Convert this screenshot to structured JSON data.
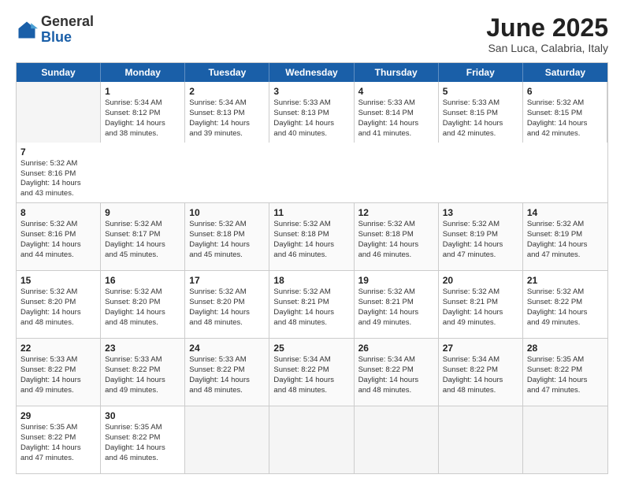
{
  "logo": {
    "general": "General",
    "blue": "Blue"
  },
  "header": {
    "month": "June 2025",
    "location": "San Luca, Calabria, Italy"
  },
  "days": [
    "Sunday",
    "Monday",
    "Tuesday",
    "Wednesday",
    "Thursday",
    "Friday",
    "Saturday"
  ],
  "rows": [
    [
      {
        "day": "",
        "empty": true
      },
      {
        "day": "2",
        "lines": [
          "Sunrise: 5:34 AM",
          "Sunset: 8:13 PM",
          "Daylight: 14 hours",
          "and 39 minutes."
        ]
      },
      {
        "day": "3",
        "lines": [
          "Sunrise: 5:33 AM",
          "Sunset: 8:13 PM",
          "Daylight: 14 hours",
          "and 40 minutes."
        ]
      },
      {
        "day": "4",
        "lines": [
          "Sunrise: 5:33 AM",
          "Sunset: 8:14 PM",
          "Daylight: 14 hours",
          "and 41 minutes."
        ]
      },
      {
        "day": "5",
        "lines": [
          "Sunrise: 5:33 AM",
          "Sunset: 8:15 PM",
          "Daylight: 14 hours",
          "and 42 minutes."
        ]
      },
      {
        "day": "6",
        "lines": [
          "Sunrise: 5:32 AM",
          "Sunset: 8:15 PM",
          "Daylight: 14 hours",
          "and 42 minutes."
        ]
      },
      {
        "day": "7",
        "lines": [
          "Sunrise: 5:32 AM",
          "Sunset: 8:16 PM",
          "Daylight: 14 hours",
          "and 43 minutes."
        ]
      }
    ],
    [
      {
        "day": "8",
        "lines": [
          "Sunrise: 5:32 AM",
          "Sunset: 8:16 PM",
          "Daylight: 14 hours",
          "and 44 minutes."
        ]
      },
      {
        "day": "9",
        "lines": [
          "Sunrise: 5:32 AM",
          "Sunset: 8:17 PM",
          "Daylight: 14 hours",
          "and 45 minutes."
        ]
      },
      {
        "day": "10",
        "lines": [
          "Sunrise: 5:32 AM",
          "Sunset: 8:18 PM",
          "Daylight: 14 hours",
          "and 45 minutes."
        ]
      },
      {
        "day": "11",
        "lines": [
          "Sunrise: 5:32 AM",
          "Sunset: 8:18 PM",
          "Daylight: 14 hours",
          "and 46 minutes."
        ]
      },
      {
        "day": "12",
        "lines": [
          "Sunrise: 5:32 AM",
          "Sunset: 8:18 PM",
          "Daylight: 14 hours",
          "and 46 minutes."
        ]
      },
      {
        "day": "13",
        "lines": [
          "Sunrise: 5:32 AM",
          "Sunset: 8:19 PM",
          "Daylight: 14 hours",
          "and 47 minutes."
        ]
      },
      {
        "day": "14",
        "lines": [
          "Sunrise: 5:32 AM",
          "Sunset: 8:19 PM",
          "Daylight: 14 hours",
          "and 47 minutes."
        ]
      }
    ],
    [
      {
        "day": "15",
        "lines": [
          "Sunrise: 5:32 AM",
          "Sunset: 8:20 PM",
          "Daylight: 14 hours",
          "and 48 minutes."
        ]
      },
      {
        "day": "16",
        "lines": [
          "Sunrise: 5:32 AM",
          "Sunset: 8:20 PM",
          "Daylight: 14 hours",
          "and 48 minutes."
        ]
      },
      {
        "day": "17",
        "lines": [
          "Sunrise: 5:32 AM",
          "Sunset: 8:20 PM",
          "Daylight: 14 hours",
          "and 48 minutes."
        ]
      },
      {
        "day": "18",
        "lines": [
          "Sunrise: 5:32 AM",
          "Sunset: 8:21 PM",
          "Daylight: 14 hours",
          "and 48 minutes."
        ]
      },
      {
        "day": "19",
        "lines": [
          "Sunrise: 5:32 AM",
          "Sunset: 8:21 PM",
          "Daylight: 14 hours",
          "and 49 minutes."
        ]
      },
      {
        "day": "20",
        "lines": [
          "Sunrise: 5:32 AM",
          "Sunset: 8:21 PM",
          "Daylight: 14 hours",
          "and 49 minutes."
        ]
      },
      {
        "day": "21",
        "lines": [
          "Sunrise: 5:32 AM",
          "Sunset: 8:22 PM",
          "Daylight: 14 hours",
          "and 49 minutes."
        ]
      }
    ],
    [
      {
        "day": "22",
        "lines": [
          "Sunrise: 5:33 AM",
          "Sunset: 8:22 PM",
          "Daylight: 14 hours",
          "and 49 minutes."
        ]
      },
      {
        "day": "23",
        "lines": [
          "Sunrise: 5:33 AM",
          "Sunset: 8:22 PM",
          "Daylight: 14 hours",
          "and 49 minutes."
        ]
      },
      {
        "day": "24",
        "lines": [
          "Sunrise: 5:33 AM",
          "Sunset: 8:22 PM",
          "Daylight: 14 hours",
          "and 48 minutes."
        ]
      },
      {
        "day": "25",
        "lines": [
          "Sunrise: 5:34 AM",
          "Sunset: 8:22 PM",
          "Daylight: 14 hours",
          "and 48 minutes."
        ]
      },
      {
        "day": "26",
        "lines": [
          "Sunrise: 5:34 AM",
          "Sunset: 8:22 PM",
          "Daylight: 14 hours",
          "and 48 minutes."
        ]
      },
      {
        "day": "27",
        "lines": [
          "Sunrise: 5:34 AM",
          "Sunset: 8:22 PM",
          "Daylight: 14 hours",
          "and 48 minutes."
        ]
      },
      {
        "day": "28",
        "lines": [
          "Sunrise: 5:35 AM",
          "Sunset: 8:22 PM",
          "Daylight: 14 hours",
          "and 47 minutes."
        ]
      }
    ],
    [
      {
        "day": "29",
        "lines": [
          "Sunrise: 5:35 AM",
          "Sunset: 8:22 PM",
          "Daylight: 14 hours",
          "and 47 minutes."
        ]
      },
      {
        "day": "30",
        "lines": [
          "Sunrise: 5:35 AM",
          "Sunset: 8:22 PM",
          "Daylight: 14 hours",
          "and 46 minutes."
        ]
      },
      {
        "day": "",
        "empty": true
      },
      {
        "day": "",
        "empty": true
      },
      {
        "day": "",
        "empty": true
      },
      {
        "day": "",
        "empty": true
      },
      {
        "day": "",
        "empty": true
      }
    ]
  ],
  "row0_col1": {
    "day": "1",
    "lines": [
      "Sunrise: 5:34 AM",
      "Sunset: 8:12 PM",
      "Daylight: 14 hours",
      "and 38 minutes."
    ]
  }
}
